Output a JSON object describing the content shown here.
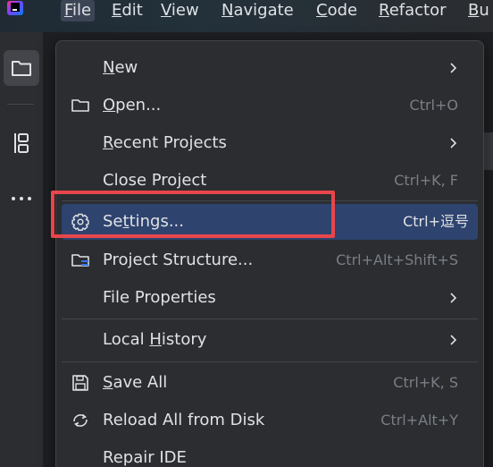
{
  "menubar": {
    "items": [
      "File",
      "Edit",
      "View",
      "Navigate",
      "Code",
      "Refactor",
      "Bu"
    ]
  },
  "toolstrip": {
    "icons": [
      "folder-icon",
      "structure-icon",
      "more-icon"
    ]
  },
  "file_menu": {
    "items": [
      {
        "label_pre": "",
        "label_mn": "N",
        "label_post": "ew",
        "shortcut": "",
        "submenu": true,
        "icon": ""
      },
      {
        "label_pre": "",
        "label_mn": "O",
        "label_post": "pen...",
        "shortcut": "Ctrl+O",
        "submenu": false,
        "icon": "folder-icon"
      },
      {
        "label_pre": "",
        "label_mn": "R",
        "label_post": "ecent Projects",
        "shortcut": "",
        "submenu": true,
        "icon": ""
      },
      {
        "label_pre": "Close Pro",
        "label_mn": "j",
        "label_post": "ect",
        "shortcut": "Ctrl+K, F",
        "submenu": false,
        "icon": ""
      },
      {
        "label_pre": "Se",
        "label_mn": "t",
        "label_post": "tings...",
        "shortcut": "Ctrl+逗号",
        "submenu": false,
        "icon": "gear-icon"
      },
      {
        "label_pre": "Project Structure...",
        "label_mn": "",
        "label_post": "",
        "shortcut": "Ctrl+Alt+Shift+S",
        "submenu": false,
        "icon": "project-structure-icon"
      },
      {
        "label_pre": "File Properties",
        "label_mn": "",
        "label_post": "",
        "shortcut": "",
        "submenu": true,
        "icon": ""
      },
      {
        "label_pre": "Local ",
        "label_mn": "H",
        "label_post": "istory",
        "shortcut": "",
        "submenu": true,
        "icon": ""
      },
      {
        "label_pre": "",
        "label_mn": "S",
        "label_post": "ave All",
        "shortcut": "Ctrl+K, S",
        "submenu": false,
        "icon": "save-icon"
      },
      {
        "label_pre": "Reload All from Disk",
        "label_mn": "",
        "label_post": "",
        "shortcut": "Ctrl+Alt+Y",
        "submenu": false,
        "icon": "reload-icon"
      },
      {
        "label_pre": "Repair IDE",
        "label_mn": "",
        "label_post": "",
        "shortcut": "",
        "submenu": false,
        "icon": ""
      }
    ]
  },
  "colors": {
    "highlight": "#2e436e",
    "annotation": "#e8464c",
    "menu_bg": "#2b2d30"
  }
}
